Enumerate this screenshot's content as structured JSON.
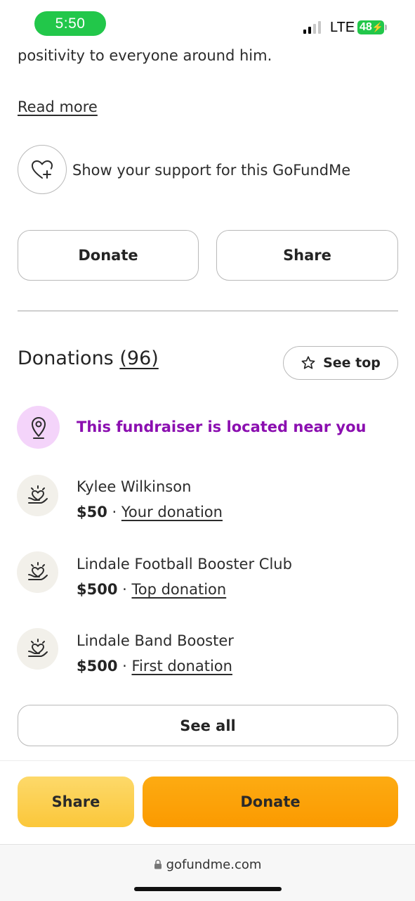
{
  "status_bar": {
    "time": "5:50",
    "network": "LTE",
    "battery": "48"
  },
  "story": {
    "visible_text": "positivity to everyone around him.",
    "read_more_label": "Read more"
  },
  "support": {
    "label": "Show your support for this GoFundMe",
    "icon": "heart-plus-icon"
  },
  "actions": {
    "donate_label": "Donate",
    "share_label": "Share"
  },
  "donations": {
    "title": "Donations",
    "count": "(96)",
    "see_top_label": "See top",
    "location_notice": "This fundraiser is located near you",
    "items": [
      {
        "name": "Kylee Wilkinson",
        "amount": "$50",
        "separator": " · ",
        "tag": "Your donation"
      },
      {
        "name": "Lindale Football Booster Club",
        "amount": "$500",
        "separator": " · ",
        "tag": "Top donation"
      },
      {
        "name": "Lindale Band Booster",
        "amount": "$500",
        "separator": " · ",
        "tag": "First donation"
      }
    ],
    "see_all_label": "See all"
  },
  "bottom_actions": {
    "share_label": "Share",
    "donate_label": "Donate"
  },
  "browser": {
    "url": "gofundme.com"
  },
  "colors": {
    "accent_purple": "#8b0fb0",
    "pin_bg": "#f4d4fa",
    "donate_orange": "#fb9a00",
    "share_yellow": "#fbc73a",
    "status_green": "#22c74a"
  }
}
